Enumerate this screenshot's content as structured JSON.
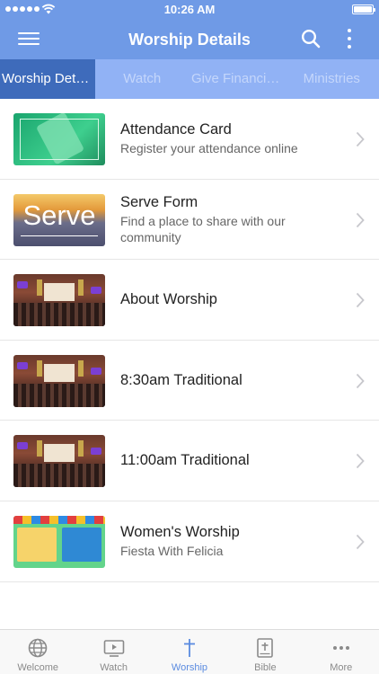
{
  "status_bar": {
    "time": "10:26 AM"
  },
  "app_bar": {
    "title": "Worship Details"
  },
  "tabs": [
    {
      "label": "Worship Details",
      "active": true
    },
    {
      "label": "Watch",
      "active": false
    },
    {
      "label": "Give Financially",
      "active": false
    },
    {
      "label": "Ministries",
      "active": false
    }
  ],
  "list": [
    {
      "title": "Attendance Card",
      "subtitle": "Register your attendance online",
      "thumb": "attendance"
    },
    {
      "title": "Serve Form",
      "subtitle": "Find a place to share with our community",
      "thumb": "serve",
      "thumb_text": "Serve"
    },
    {
      "title": "About Worship",
      "subtitle": "",
      "thumb": "church"
    },
    {
      "title": "8:30am Traditional",
      "subtitle": "",
      "thumb": "church"
    },
    {
      "title": "11:00am Traditional",
      "subtitle": "",
      "thumb": "church"
    },
    {
      "title": "Women's Worship",
      "subtitle": "Fiesta With Felicia",
      "thumb": "women"
    }
  ],
  "bottom_nav": [
    {
      "label": "Welcome",
      "icon": "globe-icon",
      "active": false
    },
    {
      "label": "Watch",
      "icon": "tv-play-icon",
      "active": false
    },
    {
      "label": "Worship",
      "icon": "cross-icon",
      "active": true
    },
    {
      "label": "Bible",
      "icon": "bible-icon",
      "active": false
    },
    {
      "label": "More",
      "icon": "more-dots-icon",
      "active": false
    }
  ],
  "colors": {
    "app_bar": "#6f9ae6",
    "tab_bar": "#91b2f5",
    "tab_active": "#3e6bbb",
    "nav_active": "#5b8be0",
    "nav_inactive": "#8a8a8a"
  }
}
